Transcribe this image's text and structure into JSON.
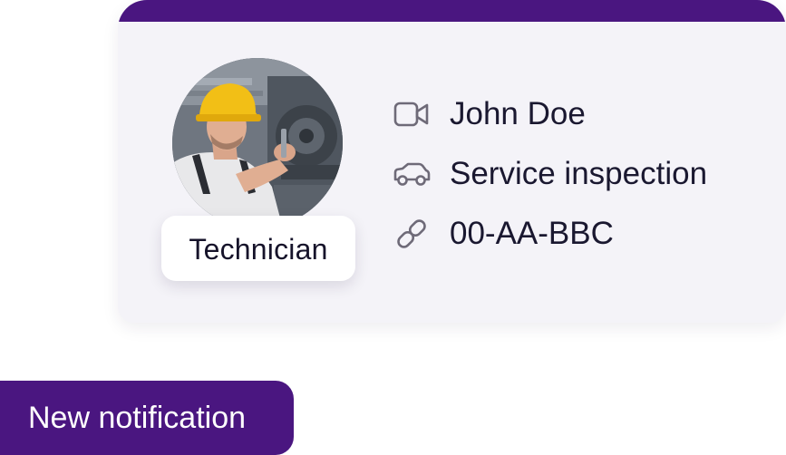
{
  "card": {
    "role": "Technician",
    "details": [
      {
        "icon": "video-camera-icon",
        "text": "John Doe"
      },
      {
        "icon": "car-icon",
        "text": "Service inspection"
      },
      {
        "icon": "link-icon",
        "text": "00-AA-BBC"
      }
    ]
  },
  "notification": {
    "label": "New notification"
  },
  "colors": {
    "accent": "#4a1680",
    "card_background": "#f4f3f8",
    "text": "#1a1830",
    "icon": "#6e6a78"
  }
}
